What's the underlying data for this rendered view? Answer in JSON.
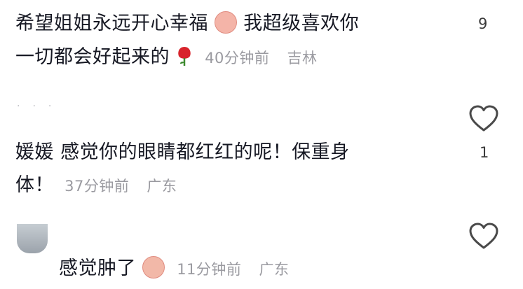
{
  "comments": [
    {
      "text_line1": "希望姐姐永远开心幸福",
      "text_line1b": "我超级喜欢你",
      "text_line2": "一切都会好起来的",
      "emoji1": "blush-face-emoji",
      "emoji2": "rose-emoji",
      "time": "40分钟前",
      "location": "吉林",
      "likes": "9"
    },
    {
      "author": "媛媛",
      "text": "感觉你的眼睛都红红的呢！保重身",
      "text_line2": "体！",
      "time": "37分钟前",
      "location": "广东",
      "likes": "1"
    },
    {
      "text": "感觉肿了",
      "emoji": "sad-face-emoji",
      "time": "11分钟前",
      "location": "广东"
    }
  ],
  "icons": {
    "heart": "heart-icon",
    "avatar": "avatar"
  },
  "colors": {
    "text": "#161823",
    "meta": "#9a9aa0",
    "heart_stroke": "#4a4a4a"
  }
}
